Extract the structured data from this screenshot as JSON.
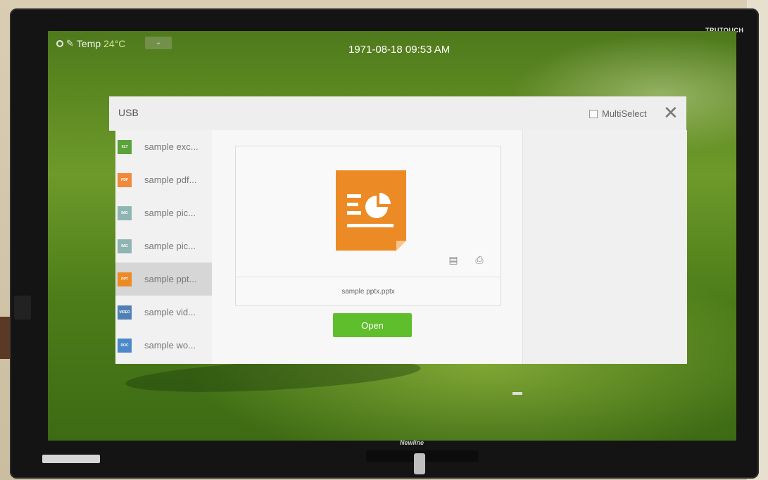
{
  "monitor": {
    "brand_top": "TRUTOUCH",
    "brand_bottom": "Newline"
  },
  "status_bar": {
    "temp_label": "Temp",
    "temp_value": "24°C",
    "dropdown_glyph": "⌄",
    "clock": "1971-08-18 09:53 AM"
  },
  "dialog": {
    "title": "USB",
    "multiselect_label": "MultiSelect",
    "multiselect_checked": false,
    "close_glyph": "✕",
    "files": [
      {
        "type": "XLT",
        "name": "sample exc...",
        "color": "#5aa23a",
        "selected": false
      },
      {
        "type": "PDF",
        "name": "sample pdf...",
        "color": "#ef8a3a",
        "selected": false
      },
      {
        "type": "IMG",
        "name": "sample pic...",
        "color": "#8fb5b3",
        "selected": false
      },
      {
        "type": "IMG",
        "name": "sample pic...",
        "color": "#8fb5b3",
        "selected": false
      },
      {
        "type": "PPT",
        "name": "sample ppt...",
        "color": "#ec8a25",
        "selected": true
      },
      {
        "type": "VIDEO",
        "name": "sample vid...",
        "color": "#4f7fb5",
        "selected": false
      },
      {
        "type": "DOC",
        "name": "sample wo...",
        "color": "#4a88c9",
        "selected": false
      }
    ],
    "preview": {
      "file_name": "sample pptx.pptx",
      "icon_color": "#ec8a25",
      "actions": [
        "details-icon",
        "print-icon"
      ]
    },
    "open_label": "Open",
    "open_color": "#5fbe2c"
  }
}
